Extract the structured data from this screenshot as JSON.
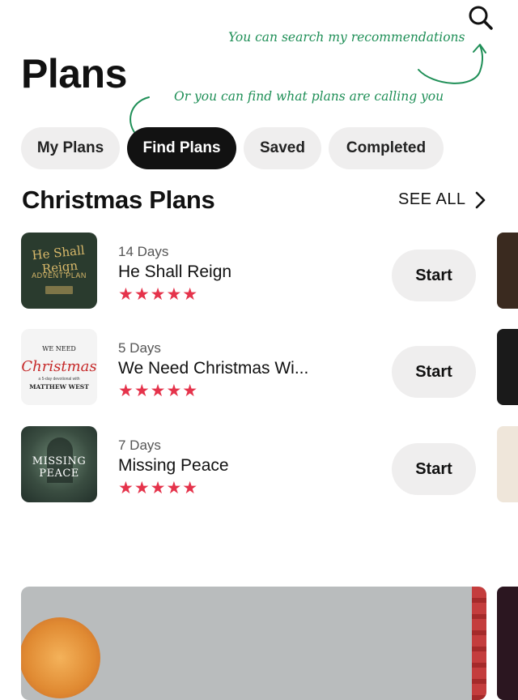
{
  "header": {
    "title": "Plans",
    "search_icon": "search-icon"
  },
  "annotations": {
    "search_note": "You can search my recommendations",
    "find_note": "Or you can find what plans are calling you",
    "color": "#1f8f57"
  },
  "tabs": [
    {
      "label": "My Plans",
      "active": false
    },
    {
      "label": "Find Plans",
      "active": true
    },
    {
      "label": "Saved",
      "active": false
    },
    {
      "label": "Completed",
      "active": false
    }
  ],
  "section": {
    "title": "Christmas Plans",
    "see_all": "SEE ALL",
    "see_all_icon": "chevron-right-icon"
  },
  "plans": [
    {
      "days": "14 Days",
      "name": "He Shall Reign",
      "stars": "★★★★★",
      "action": "Start",
      "thumb": {
        "line1": "He Shall Reign",
        "line2": "ADVENT PLAN"
      }
    },
    {
      "days": "5 Days",
      "name": "We Need Christmas Wi...",
      "stars": "★★★★★",
      "action": "Start",
      "thumb": {
        "line1": "WE NEED",
        "line2": "Christmas",
        "line3": "a 5-day devotional with",
        "line4": "MATTHEW WEST"
      }
    },
    {
      "days": "7 Days",
      "name": "Missing Peace",
      "stars": "★★★★★",
      "action": "Start",
      "thumb": {
        "line1": "MISSING PEACE"
      }
    }
  ],
  "colors": {
    "accent_star": "#e5334b",
    "active_tab_bg": "#121212",
    "pill_bg": "#efeeee"
  }
}
